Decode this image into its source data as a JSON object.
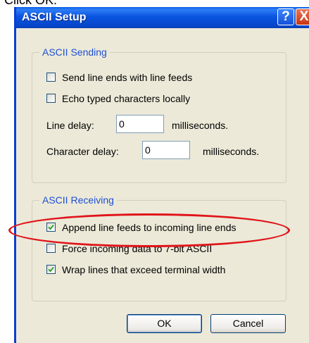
{
  "caption": "Click OK.",
  "window": {
    "title": "ASCII Setup",
    "help_glyph": "?",
    "close_glyph": "X"
  },
  "sending": {
    "legend": "ASCII Sending",
    "send_line_ends": {
      "label": "Send line ends with line feeds",
      "checked": false
    },
    "echo_locally": {
      "label": "Echo typed characters locally",
      "checked": false
    },
    "line_delay": {
      "label": "Line delay:",
      "value": "0",
      "unit": "milliseconds."
    },
    "char_delay": {
      "label": "Character delay:",
      "value": "0",
      "unit": "milliseconds."
    }
  },
  "receiving": {
    "legend": "ASCII Receiving",
    "append_line_feeds": {
      "label": "Append line feeds to incoming line ends",
      "checked": true
    },
    "force_7bit": {
      "label": "Force incoming data to 7-bit ASCII",
      "checked": false
    },
    "wrap_lines": {
      "label": "Wrap lines that exceed terminal width",
      "checked": true
    }
  },
  "buttons": {
    "ok": "OK",
    "cancel": "Cancel"
  },
  "colors": {
    "annotation_oval": "#e0141a",
    "title_bar": "#0b54e0",
    "legend_text": "#1c4fd4"
  }
}
